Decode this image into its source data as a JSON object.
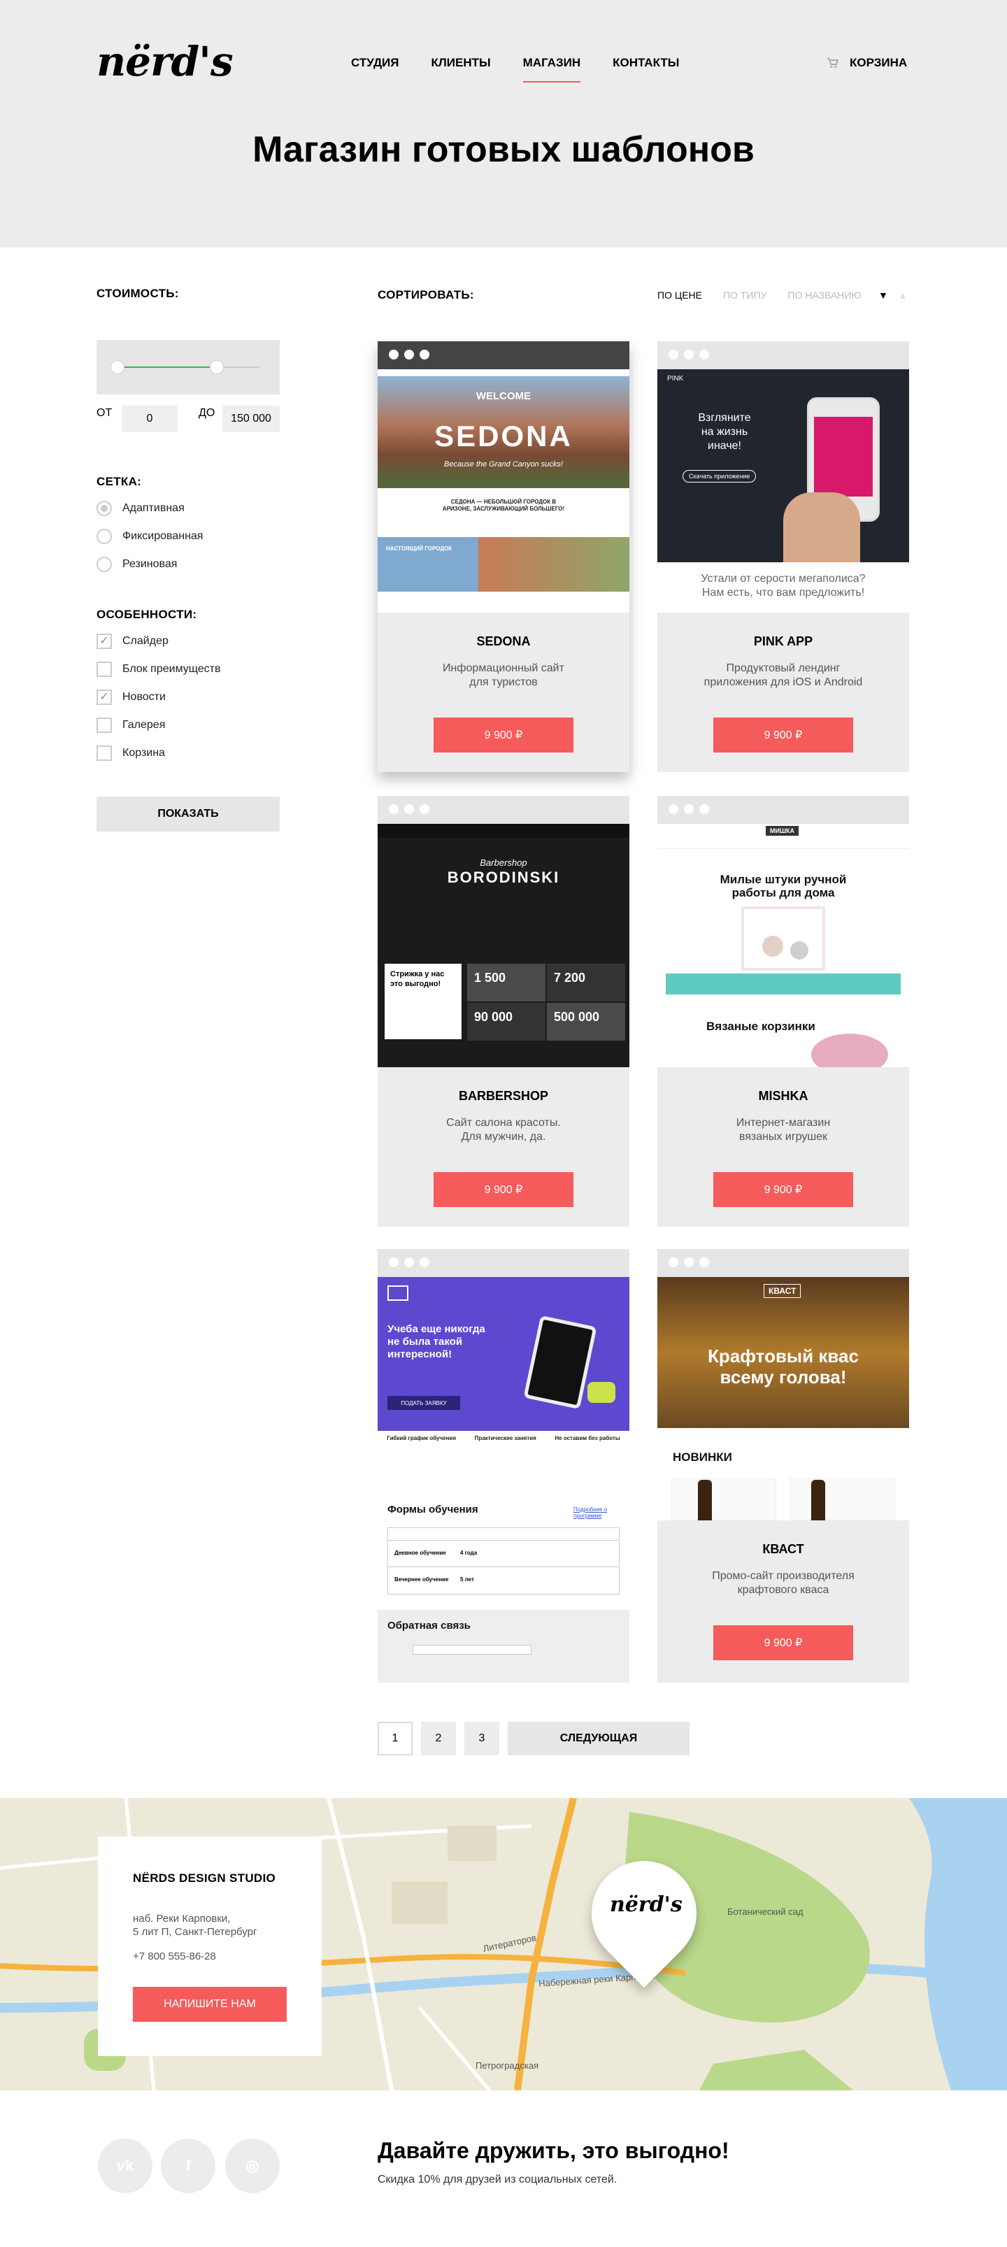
{
  "header": {
    "logo": "nërd's",
    "nav": [
      "СТУДИЯ",
      "КЛИЕНТЫ",
      "МАГАЗИН",
      "КОНТАКТЫ"
    ],
    "active_nav": "МАГАЗИН",
    "cart_label": "КОРЗИНА",
    "title": "Магазин готовых шаблонов"
  },
  "filters": {
    "price_label": "СТОИМОСТЬ:",
    "from_label": "ОТ",
    "from_value": "0",
    "to_label": "ДО",
    "to_value": "150 000",
    "price_range_selected_fraction": [
      0.0,
      0.69
    ],
    "grid_label": "СЕТКА:",
    "grid_options": [
      {
        "label": "Адаптивная",
        "checked": true
      },
      {
        "label": "Фиксированная",
        "checked": false
      },
      {
        "label": "Резиновая",
        "checked": false
      }
    ],
    "features_label": "ОСОБЕННОСТИ:",
    "features": [
      {
        "label": "Слайдер",
        "checked": true
      },
      {
        "label": "Блок преимуществ",
        "checked": false
      },
      {
        "label": "Новости",
        "checked": true
      },
      {
        "label": "Галерея",
        "checked": false
      },
      {
        "label": "Корзина",
        "checked": false
      }
    ],
    "show_button": "ПОКАЗАТЬ"
  },
  "sort": {
    "label": "СОРТИРОВАТЬ:",
    "options": [
      "ПО ЦЕНЕ",
      "ПО ТИПУ",
      "ПО НАЗВАНИЮ"
    ],
    "active": "ПО ЦЕНЕ",
    "arrow_down": "▼",
    "arrow_up": "▲"
  },
  "products": [
    {
      "name": "SEDONA",
      "desc": "Информационный сайт\nдля туристов",
      "price": "9 900 ₽",
      "shot": {
        "welcome": "WELCOME",
        "brand": "SEDONA",
        "tagline": "Because the Grand Canyon sucks!",
        "caption": "СЕДОНА — НЕБОЛЬШОЙ ГОРОДОК В АРИЗОНЕ, ЗАСЛУЖИВАЮЩИЙ БОЛЬШЕГО!",
        "block": "НАСТОЯЩИЙ ГОРОДОК"
      }
    },
    {
      "name": "PINK APP",
      "desc": "Продуктовый лендинг\nприложения для iOS и Android",
      "price": "9 900 ₽",
      "shot": {
        "brand": "PINK",
        "headline": "Взгляните\nна жизнь\nиначе!",
        "cta": "Скачать приложение",
        "bottom": "Устали от серости мегаполиса?\nНам есть, что вам предложить!"
      }
    },
    {
      "name": "BARBERSHOP",
      "desc": "Сайт салона красоты.\nДля мужчин, да.",
      "price": "9 900 ₽",
      "shot": {
        "script": "Barbershop",
        "brand": "BORODINSKI",
        "promo": "Стрижка у нас это выгодно!",
        "stats": [
          "1 500",
          "7 200",
          "90 000",
          "500 000"
        ]
      }
    },
    {
      "name": "MISHKA",
      "desc": "Интернет-магазин\nвязаных игрушек",
      "price": "9 900 ₽",
      "shot": {
        "logo": "МИШКА",
        "headline": "Милые штуки ручной\nработы для дома",
        "sub": "Вязаные корзинки"
      }
    },
    {
      "name": "",
      "desc": "",
      "price": "",
      "shot": {
        "headline": "Учеба еще никогда\nне была такой\nинтересной!",
        "cta": "ПОДАТЬ ЗАЯВКУ",
        "features": [
          "Гибкий график обучения",
          "Практические занятия",
          "Не оставим без работы"
        ],
        "forms_title": "Формы обучения",
        "forms_link": "Подробнее о программе",
        "rows": [
          "Дневное обучение",
          "Вечернее обучение"
        ],
        "terms": [
          "4 года",
          "5 лет"
        ],
        "feedback": "Обратная связь"
      }
    },
    {
      "name": "КВАСТ",
      "desc": "Промо-сайт производителя\nкрафтового кваса",
      "price": "9 900 ₽",
      "shot": {
        "logo": "КВАСТ",
        "headline": "Крафтовый квас\nвсему голова!",
        "news": "НОВИНКИ"
      }
    }
  ],
  "pagination": {
    "pages": [
      "1",
      "2",
      "3"
    ],
    "current": "1",
    "next": "СЛЕДУЮЩАЯ"
  },
  "contact": {
    "title": "NËRDS DESIGN STUDIO",
    "address1": "наб. Реки Карповки,",
    "address2": "5 лит П, Санкт-Петербург",
    "phone": "+7 800 555-86-28",
    "button": "НАПИШИТЕ НАМ",
    "map_labels": [
      "Ботанический сад",
      "Литераторов",
      "Набережная реки Карповки",
      "Петроградская"
    ],
    "map_logo": "nërd's"
  },
  "friends": {
    "title": "Давайте дружить, это выгодно!",
    "subtitle": "Скидка 10% для друзей из социальных сетей.",
    "social": [
      "vk-icon",
      "facebook-icon",
      "instagram-icon"
    ],
    "social_glyphs": [
      "vk",
      "f",
      "◎"
    ]
  },
  "colors": {
    "accent": "#f55b5b",
    "header_bg": "#ececec",
    "slider_range": "#3ab54a"
  }
}
